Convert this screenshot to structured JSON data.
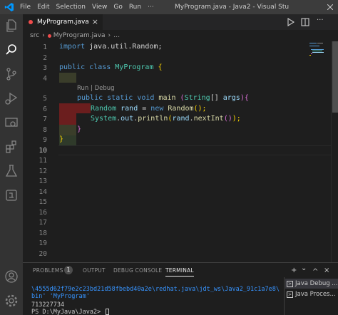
{
  "titlebar": {
    "menu": [
      "File",
      "Edit",
      "Selection",
      "View",
      "Go",
      "Run"
    ],
    "title": "MyProgram.java - Java2 - Visual Stu"
  },
  "editor_tab": {
    "label": "MyProgram.java",
    "close": "×"
  },
  "breadcrumb": {
    "folder": "src",
    "sep": "›",
    "file": "MyProgram.java",
    "more": "…"
  },
  "editor": {
    "codelens": "Run | Debug",
    "line_numbers": [
      "1",
      "2",
      "3",
      "4",
      "5",
      "6",
      "7",
      "8",
      "9",
      "10",
      "11",
      "12",
      "13",
      "14",
      "15",
      "16",
      "17",
      "18",
      "19",
      "20"
    ],
    "lines": {
      "l1": {
        "kw": "import",
        "rest": " java.util.Random;"
      },
      "l3": {
        "kw1": "public",
        "kw2": "class",
        "name": " MyProgram ",
        "brace": "{"
      },
      "l5": {
        "kw1": "public",
        "kw2": "static",
        "kw3": "void",
        "fn": " main",
        "p_open": " (",
        "type": "String",
        "arr": "[] ",
        "arg": "args",
        "p_close": ")",
        "brace": "{"
      },
      "l6": {
        "type": "Random",
        "var": " rand",
        "eq": " = ",
        "kw": "new",
        "ctor": " Random",
        "paren": "();"
      },
      "l7": {
        "obj": "System",
        "d1": ".",
        "out": "out",
        "d2": ".",
        "fn": "println",
        "o1": "(",
        "rand": "rand",
        "d3": ".",
        "fn2": "nextInt",
        "o2": "()",
        "c1": ");"
      },
      "l8": {
        "brace": "}"
      },
      "l9": {
        "brace": "}"
      }
    }
  },
  "panel": {
    "tabs": {
      "problems": "PROBLEMS",
      "output": "OUTPUT",
      "debug_console": "DEBUG CONSOLE",
      "terminal": "TERMINAL"
    },
    "problems_count": "1",
    "actions": {
      "add": "+",
      "dropdown": "⌄",
      "up": "^",
      "close": "×"
    },
    "terminal_lines": [
      "\\4555d62f79e2c23bd21d58fbebd40a2e\\redhat.java\\jdt_ws\\Java2_91c1a7e8\\",
      "bin' 'MyProgram'",
      "713227734",
      "PS D:\\MyJava\\Java2> "
    ],
    "terminal_list": [
      "Java Debug ...",
      "Java Proces..."
    ]
  },
  "colors": {
    "accent": "#007acc",
    "error": "#f14c4c",
    "keyword": "#569cd6",
    "type": "#4ec9b0",
    "function": "#dcdcaa"
  }
}
